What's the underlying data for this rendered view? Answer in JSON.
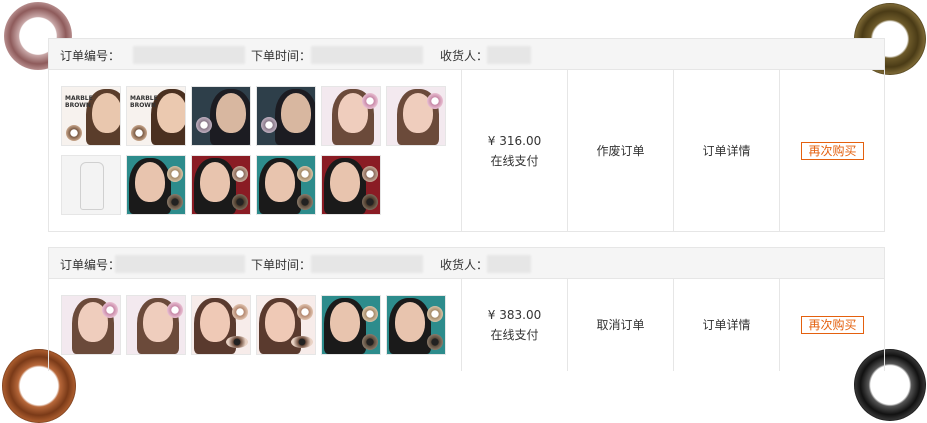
{
  "orders": [
    {
      "header": {
        "order_no_label": "订单编号：",
        "order_time_label": "下单时间：",
        "receiver_label": "收货人："
      },
      "price": "¥ 316.00",
      "payment": "在线支付",
      "action": "作废订单",
      "detail": "订单详情",
      "buy_again": "再次购买",
      "product_thumbs": [
        {
          "icon": "marble-brown-lens-product"
        },
        {
          "icon": "marble-brown-lens-product"
        },
        {
          "icon": "lens-product-dark"
        },
        {
          "icon": "lens-product-dark"
        },
        {
          "icon": "lens-product-pink"
        },
        {
          "icon": "lens-product-pink"
        },
        {
          "icon": "solution-bottle-product"
        },
        {
          "icon": "lens-product-teal"
        },
        {
          "icon": "lens-product-red"
        },
        {
          "icon": "lens-product-teal"
        },
        {
          "icon": "lens-product-red"
        }
      ]
    },
    {
      "header": {
        "order_no_label": "订单编号：",
        "order_time_label": "下单时间：",
        "receiver_label": "收货人："
      },
      "price": "¥ 383.00",
      "payment": "在线支付",
      "action": "取消订单",
      "detail": "订单详情",
      "buy_again": "再次购买",
      "product_thumbs": [
        {
          "icon": "lens-product-pink"
        },
        {
          "icon": "lens-product-pink"
        },
        {
          "icon": "lens-product-peach"
        },
        {
          "icon": "lens-product-peach"
        },
        {
          "icon": "lens-product-teal"
        },
        {
          "icon": "lens-product-teal"
        }
      ]
    }
  ],
  "marble_text": "MARBLE\nBROWN",
  "colors": {
    "accent_orange": "#e4600e",
    "border": "#e6e6e6",
    "header_bg": "#f5f5f5"
  }
}
